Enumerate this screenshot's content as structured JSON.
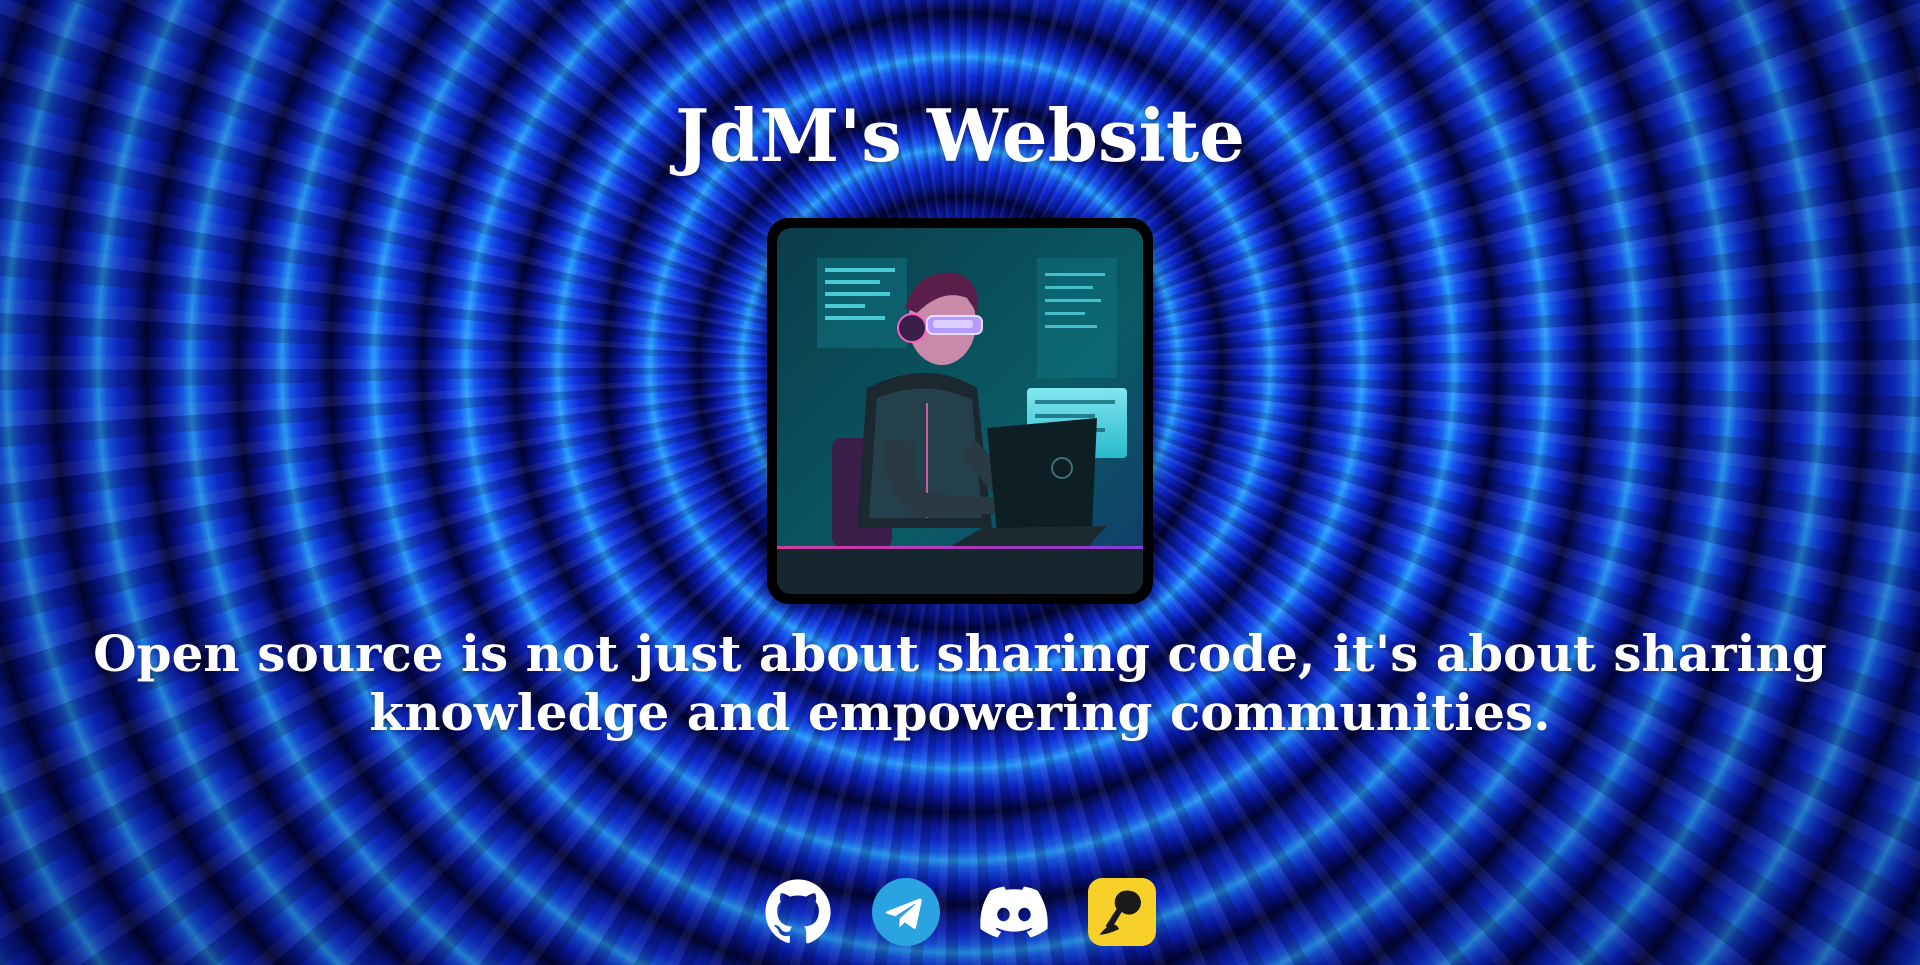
{
  "site": {
    "title": "JdM's Website",
    "tagline": "Open source is not just about sharing code, it's about sharing knowledge and empowering communities."
  },
  "avatar": {
    "icon": "cyberpunk-coder-illustration"
  },
  "socials": [
    {
      "name": "github",
      "icon": "github-icon",
      "color": "#ffffff"
    },
    {
      "name": "telegram",
      "icon": "telegram-icon",
      "color": "#2aa3e0"
    },
    {
      "name": "discord",
      "icon": "discord-icon",
      "color": "#ffffff"
    },
    {
      "name": "kofi-like",
      "icon": "yellow-app-icon",
      "color": "#f7d12a"
    }
  ],
  "colors": {
    "background_primary": "#0f2bd6",
    "background_highlight": "#2aa0ff",
    "text": "#ffffff"
  }
}
